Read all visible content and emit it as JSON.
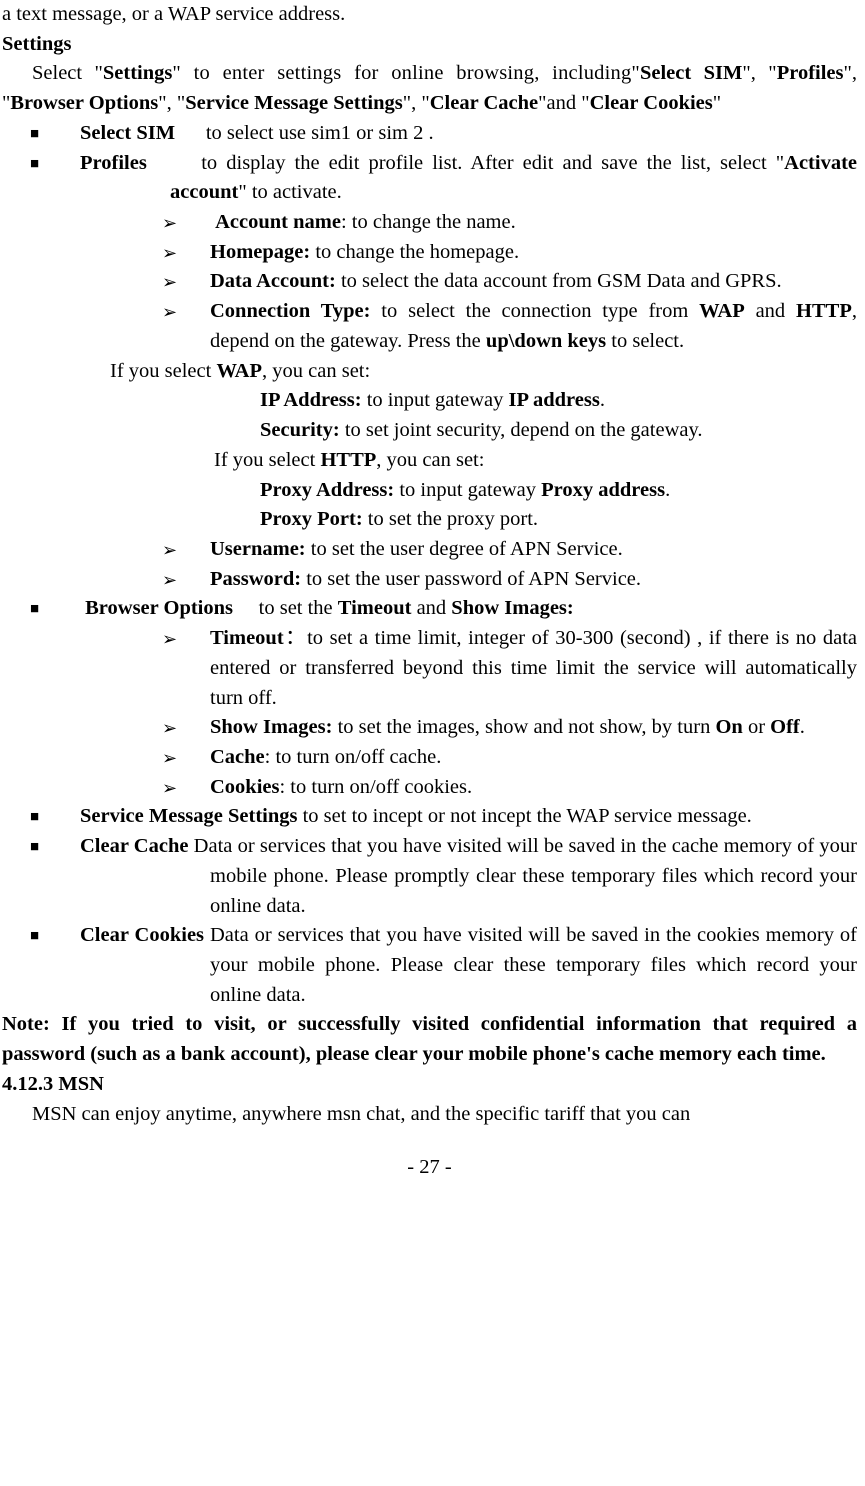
{
  "intro_line": "a text message, or a WAP service address.",
  "settings_heading": "Settings",
  "settings_intro_pre": "Select \"",
  "settings_intro_b1": "Settings",
  "settings_intro_mid1": "\" to enter settings for online browsing, including\"",
  "settings_intro_b2": "Select SIM",
  "settings_intro_mid2": "\", \"",
  "settings_intro_b3": "Profiles",
  "settings_intro_mid3": "\", \"",
  "settings_intro_b4": "Browser Options",
  "settings_intro_mid4": "\", \"",
  "settings_intro_b5": "Service Message Settings",
  "settings_intro_mid5": "\", \"",
  "settings_intro_b6": "Clear Cache",
  "settings_intro_mid6": "\"and \"",
  "settings_intro_b7": "Clear Cookies",
  "settings_intro_end": "\"",
  "select_sim_b": "Select SIM",
  "select_sim_t": "      to select use sim1 or sim 2 .",
  "profiles_b": "Profiles",
  "profiles_t1": "      to display the edit profile list. After edit and save the list, select \"",
  "profiles_b2": "Activate account",
  "profiles_t2": "\" to activate.",
  "acct_name_b": "Account name",
  "acct_name_t": ": to change the name.",
  "homepage_b": "Homepage:",
  "homepage_t": " to change the homepage.",
  "data_acct_b": "Data Account:",
  "data_acct_t": " to select the data account from GSM Data and GPRS.",
  "conn_type_b": "Connection Type:",
  "conn_type_t1": " to select the connection type from ",
  "conn_type_b2": "WAP",
  "conn_type_t2": " and ",
  "conn_type_b3": "HTTP",
  "conn_type_t3": ", depend on the gateway. Press the ",
  "conn_type_b4": "up\\down keys",
  "conn_type_t4": " to select.",
  "if_wap_t1": "If you select ",
  "if_wap_b": "WAP",
  "if_wap_t2": ", you can set:",
  "ip_addr_b": "IP Address:",
  "ip_addr_t1": " to input gateway ",
  "ip_addr_b2": "IP address",
  "ip_addr_t2": ".",
  "security_b": "Security:",
  "security_t": " to set joint security, depend on the gateway.",
  "if_http_t1": "If you select ",
  "if_http_b": "HTTP",
  "if_http_t2": ", you can set:",
  "proxy_addr_b": "Proxy Address:",
  "proxy_addr_t1": " to input gateway ",
  "proxy_addr_b2": "Proxy address",
  "proxy_addr_t2": ".",
  "proxy_port_b": "Proxy Port:",
  "proxy_port_t": " to set the proxy port.",
  "username_b": "Username:",
  "username_t": " to set the user degree of APN Service.",
  "password_b": "Password:",
  "password_t": " to set the user password of APN Service.",
  "browser_opt_b": "Browser Options",
  "browser_opt_t1": "     to set the ",
  "browser_opt_b2": "Timeout",
  "browser_opt_t2": " and ",
  "browser_opt_b3": "Show Images:",
  "timeout_b": "Timeout",
  "timeout_t": "：to set a time limit, integer of 30-300 (second) , if there is no data entered or transferred beyond this time limit the service will automatically turn off.",
  "show_img_b": "Show Images:",
  "show_img_t1": " to set the images, show and not show, by turn ",
  "show_img_b2": "On",
  "show_img_t2": " or ",
  "show_img_b3": "Off",
  "show_img_t3": ".",
  "cache_b": "Cache",
  "cache_t": ": to turn on/off cache.",
  "cookies_b": "Cookies",
  "cookies_t": ": to turn on/off cookies.",
  "svc_msg_b": "Service Message Settings",
  "svc_msg_t": " to set to incept or not incept the WAP service message.",
  "clear_cache_b": "Clear Cache",
  "clear_cache_t": " Data or services that you have visited will be saved in the cache memory of your mobile phone. Please promptly clear these temporary files which record your online data.",
  "clear_cookies_b": "Clear Cookies",
  "clear_cookies_t": " Data or services that you have visited will be saved in the cookies memory of your mobile phone. Please clear these temporary files which record your online data.",
  "note": "Note: If you tried to visit, or successfully visited confidential information that required a password (such as a bank account), please clear your mobile phone's cache memory each time.",
  "msn_heading": "4.12.3 MSN",
  "msn_text": "MSN can enjoy anytime, anywhere msn chat, and the specific tariff that you can",
  "page_number": "- 27 -"
}
